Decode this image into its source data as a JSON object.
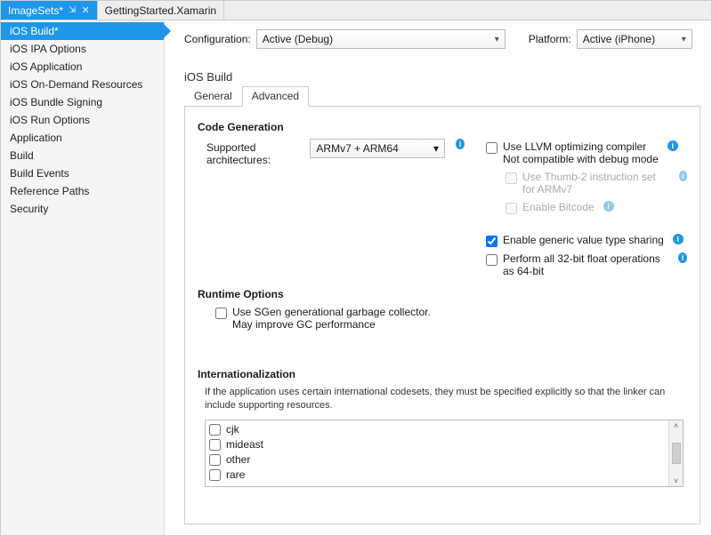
{
  "tabs": [
    {
      "label": "ImageSets*",
      "active": true
    },
    {
      "label": "GettingStarted.Xamarin",
      "active": false
    }
  ],
  "sidebar": {
    "items": [
      {
        "label": "iOS Build*",
        "active": true
      },
      {
        "label": "iOS IPA Options"
      },
      {
        "label": "iOS Application"
      },
      {
        "label": "iOS On-Demand Resources"
      },
      {
        "label": "iOS Bundle Signing"
      },
      {
        "label": "iOS Run Options"
      },
      {
        "label": "Application"
      },
      {
        "label": "Build"
      },
      {
        "label": "Build Events"
      },
      {
        "label": "Reference Paths"
      },
      {
        "label": "Security"
      }
    ]
  },
  "toolbar": {
    "configuration_label": "Configuration:",
    "configuration_value": "Active (Debug)",
    "platform_label": "Platform:",
    "platform_value": "Active (iPhone)"
  },
  "page_title": "iOS Build",
  "subtabs": {
    "general": "General",
    "advanced": "Advanced"
  },
  "code_gen": {
    "title": "Code Generation",
    "arch_label": "Supported architectures:",
    "arch_value": "ARMv7 + ARM64",
    "llvm_label": "Use LLVM optimizing compiler\nNot compatible with debug mode",
    "thumb_label": "Use Thumb-2 instruction set for ARMv7",
    "bitcode_label": "Enable Bitcode",
    "generic_label": "Enable generic value type sharing",
    "float_label": "Perform all 32-bit float operations as 64-bit"
  },
  "runtime": {
    "title": "Runtime Options",
    "sgen_label": "Use SGen generational garbage collector.\nMay improve GC performance"
  },
  "i18n": {
    "title": "Internationalization",
    "desc": "If the application uses certain international codesets, they must be specified explicitly so that the linker can include supporting resources.",
    "items": [
      {
        "label": "cjk"
      },
      {
        "label": "mideast"
      },
      {
        "label": "other"
      },
      {
        "label": "rare"
      }
    ]
  }
}
